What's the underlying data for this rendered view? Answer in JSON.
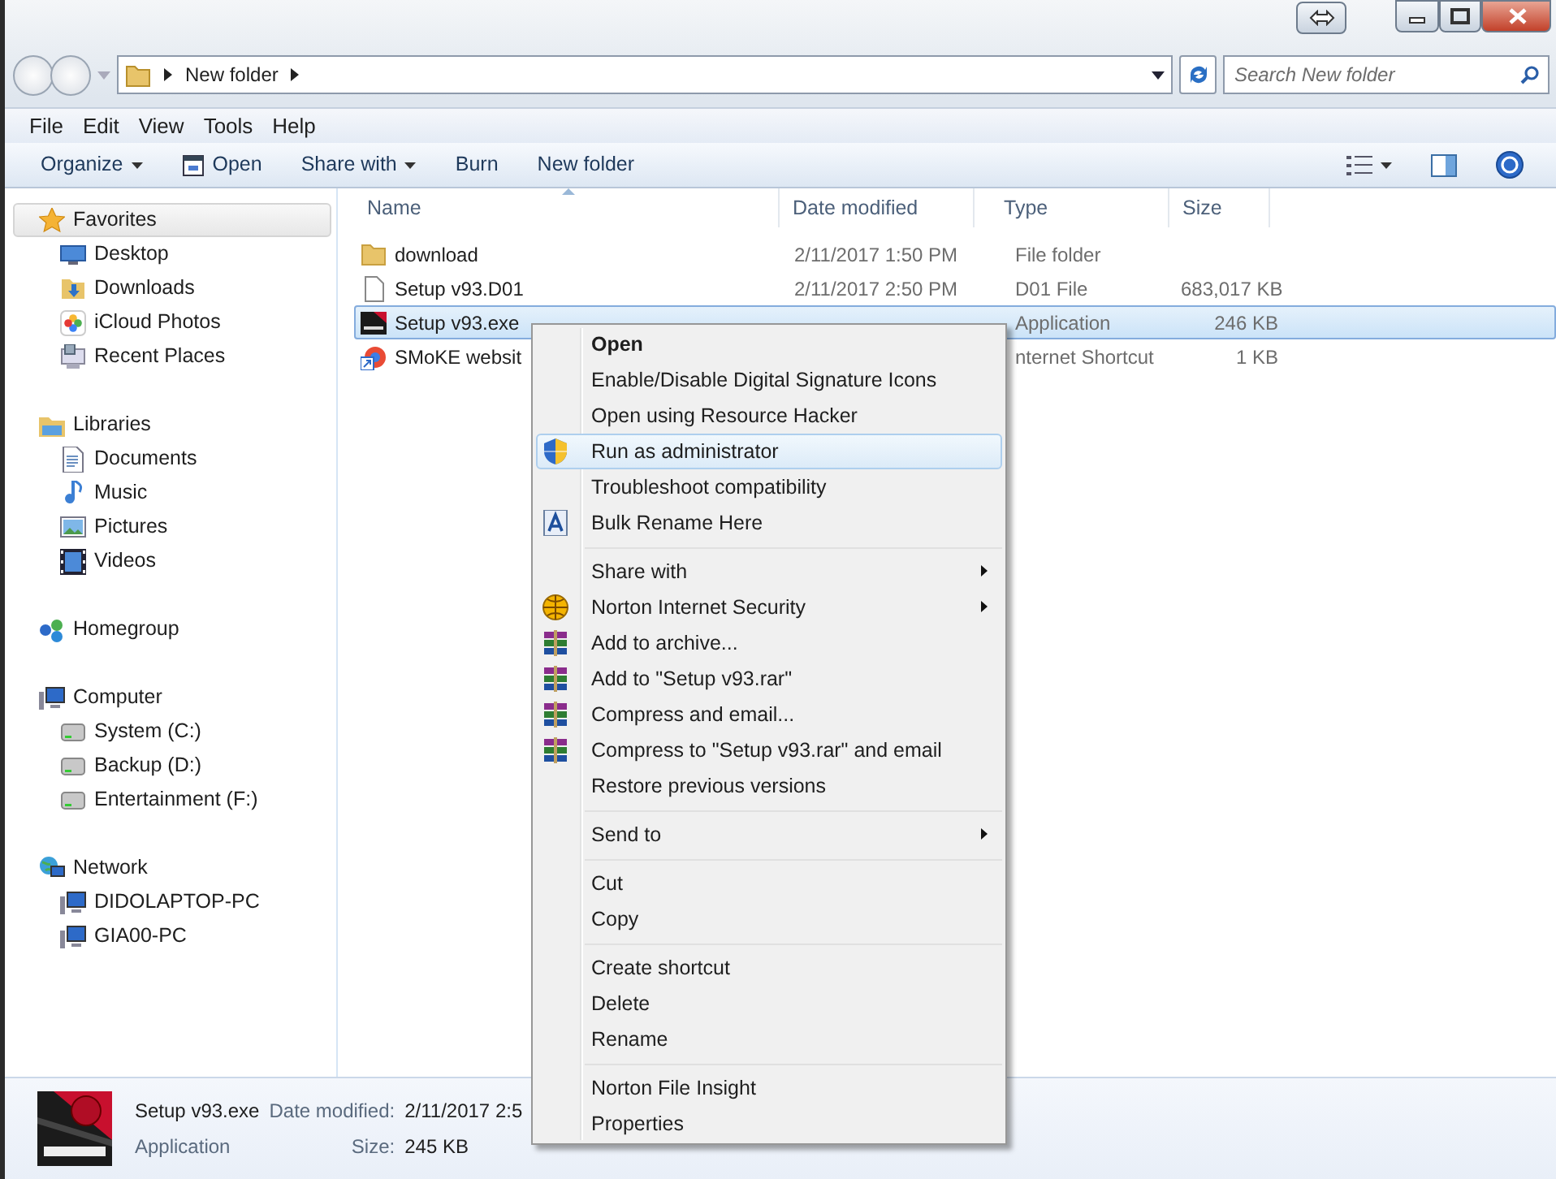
{
  "window": {
    "controls": [
      {
        "kind": "snap"
      },
      {
        "kind": "minimize"
      },
      {
        "kind": "maximize"
      },
      {
        "kind": "close"
      }
    ]
  },
  "address_bar": {
    "path": "New folder"
  },
  "search": {
    "placeholder": "Search New folder"
  },
  "menu_bar": [
    "File",
    "Edit",
    "View",
    "Tools",
    "Help"
  ],
  "toolbar": [
    {
      "label": "Organize",
      "kind": "dropdown"
    },
    {
      "label": "Open",
      "kind": "with_icon"
    },
    {
      "label": "Share with",
      "kind": "dropdown"
    },
    {
      "label": "Burn",
      "kind": "plain"
    },
    {
      "label": "New folder",
      "kind": "plain"
    }
  ],
  "sidebar": [
    {
      "label": "Favorites",
      "kind": "star",
      "selected": true,
      "children": [
        {
          "label": "Desktop",
          "kind": "desktop",
          "selected": false
        },
        {
          "label": "Downloads",
          "kind": "downloads",
          "selected": false
        },
        {
          "label": "iCloud Photos",
          "kind": "photos",
          "selected": false
        },
        {
          "label": "Recent Places",
          "kind": "recent",
          "selected": false
        }
      ]
    },
    {
      "label": "Libraries",
      "kind": "library",
      "selected": false,
      "children": [
        {
          "label": "Documents",
          "kind": "document",
          "selected": false
        },
        {
          "label": "Music",
          "kind": "music",
          "selected": false
        },
        {
          "label": "Pictures",
          "kind": "picture",
          "selected": false
        },
        {
          "label": "Videos",
          "kind": "video",
          "selected": false
        }
      ]
    },
    {
      "label": "Homegroup",
      "kind": "homegroup",
      "selected": false
    },
    {
      "label": "Computer",
      "kind": "computer",
      "selected": false,
      "children": [
        {
          "label": "System (C:)",
          "kind": "drive",
          "selected": false
        },
        {
          "label": "Backup (D:)",
          "kind": "drive",
          "selected": false
        },
        {
          "label": "Entertainment (F:)",
          "kind": "drive",
          "selected": false
        }
      ]
    },
    {
      "label": "Network",
      "kind": "network",
      "selected": false,
      "children": [
        {
          "label": "DIDOLAPTOP-PC",
          "kind": "computer",
          "selected": false
        },
        {
          "label": "GIA00-PC",
          "kind": "computer",
          "selected": false
        }
      ]
    }
  ],
  "file_list": {
    "columns": [
      "Name",
      "Date modified",
      "Type",
      "Size"
    ],
    "rows": [
      {
        "kind": "folder",
        "name": "download",
        "date": "2/11/2017 1:50 PM",
        "type": "File folder",
        "selected": false
      },
      {
        "kind": "file",
        "name": "Setup v93.D01",
        "date": "2/11/2017 2:50 PM",
        "type": "D01 File",
        "size": "683,017 KB",
        "selected": false
      },
      {
        "kind": "app",
        "name": "Setup v93.exe",
        "type": "Application",
        "size": "246 KB",
        "selected": true
      },
      {
        "kind": "shortcut",
        "name": "SMoKE websit",
        "type": "nternet Shortcut",
        "size": "1 KB",
        "selected": false
      }
    ]
  },
  "context_menu": [
    {
      "kind": "item",
      "label": "Open",
      "default": true,
      "submenu": false,
      "selected": false
    },
    {
      "kind": "item",
      "label": "Enable/Disable Digital Signature Icons",
      "default": false,
      "submenu": false,
      "selected": false
    },
    {
      "kind": "item",
      "label": "Open using Resource Hacker",
      "default": false,
      "submenu": false,
      "selected": false
    },
    {
      "kind": "shield-item",
      "label": "Run as administrator",
      "default": false,
      "submenu": false,
      "selected": true
    },
    {
      "kind": "item",
      "label": "Troubleshoot compatibility",
      "default": false,
      "submenu": false,
      "selected": false
    },
    {
      "kind": "rename-item",
      "label": "Bulk Rename Here",
      "default": false,
      "submenu": false,
      "selected": false
    },
    {
      "kind": "separator"
    },
    {
      "kind": "item",
      "label": "Share with",
      "default": false,
      "submenu": true,
      "selected": false
    },
    {
      "kind": "globe-item",
      "label": "Norton Internet Security",
      "default": false,
      "submenu": true,
      "selected": false
    },
    {
      "kind": "archive-item",
      "label": "Add to archive...",
      "default": false,
      "submenu": false,
      "selected": false
    },
    {
      "kind": "archive-item",
      "label": "Add to \"Setup v93.rar\"",
      "default": false,
      "submenu": false,
      "selected": false
    },
    {
      "kind": "archive-item",
      "label": "Compress and email...",
      "default": false,
      "submenu": false,
      "selected": false
    },
    {
      "kind": "archive-item",
      "label": "Compress to \"Setup v93.rar\" and email",
      "default": false,
      "submenu": false,
      "selected": false
    },
    {
      "kind": "item",
      "label": "Restore previous versions",
      "default": false,
      "submenu": false,
      "selected": false
    },
    {
      "kind": "separator"
    },
    {
      "kind": "item",
      "label": "Send to",
      "default": false,
      "submenu": true,
      "selected": false
    },
    {
      "kind": "separator"
    },
    {
      "kind": "item",
      "label": "Cut",
      "default": false,
      "submenu": false,
      "selected": false
    },
    {
      "kind": "item",
      "label": "Copy",
      "default": false,
      "submenu": false,
      "selected": false
    },
    {
      "kind": "separator"
    },
    {
      "kind": "item",
      "label": "Create shortcut",
      "default": false,
      "submenu": false,
      "selected": false
    },
    {
      "kind": "item",
      "label": "Delete",
      "default": false,
      "submenu": false,
      "selected": false
    },
    {
      "kind": "item",
      "label": "Rename",
      "default": false,
      "submenu": false,
      "selected": false
    },
    {
      "kind": "separator"
    },
    {
      "kind": "item",
      "label": "Norton File Insight",
      "default": false,
      "submenu": false,
      "selected": false
    },
    {
      "kind": "item",
      "label": "Properties",
      "default": false,
      "submenu": false,
      "selected": false
    }
  ],
  "details_pane": {
    "name": "Setup v93.exe",
    "date_label": "Date modified:",
    "date": "2/11/2017 2:5",
    "type": "Application",
    "size_label": "Size:",
    "size": "245 KB"
  }
}
